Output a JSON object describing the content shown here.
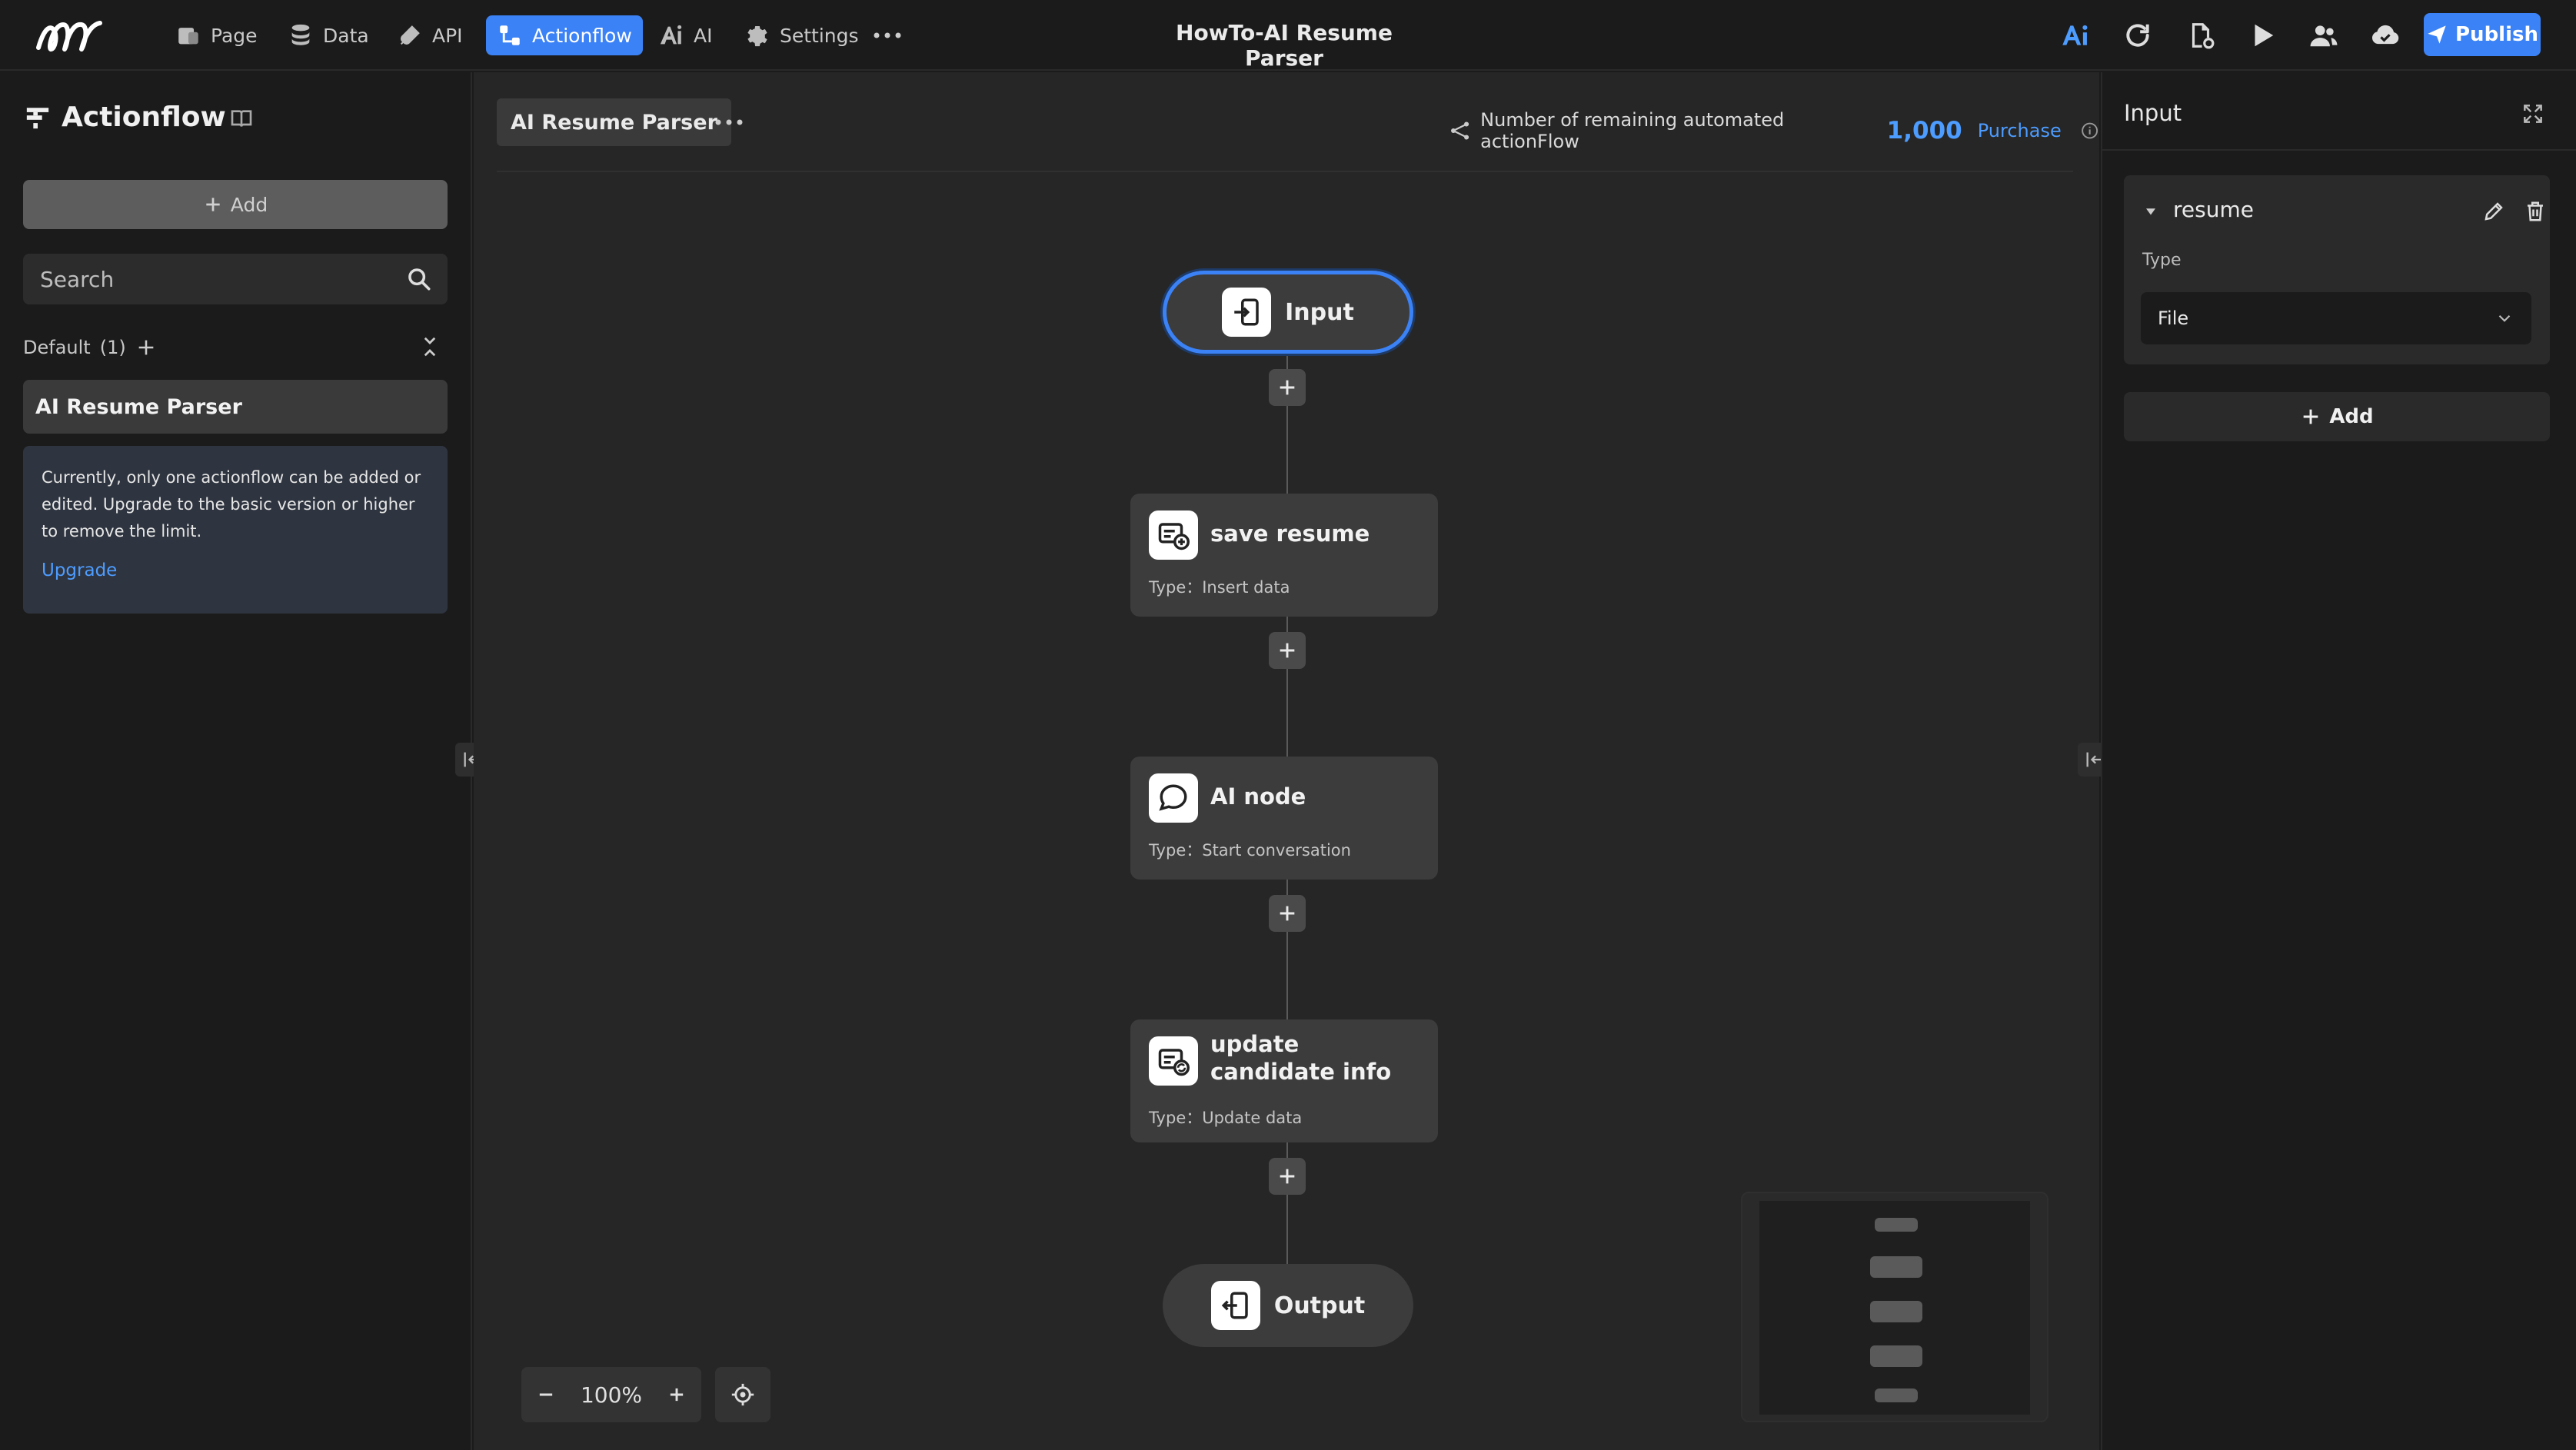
{
  "app": {
    "title": "HowTo-AI Resume Parser",
    "logo": "logo-mark",
    "accent_color": "#3b82f6",
    "nav": [
      {
        "label": "Page",
        "icon": "page-icon"
      },
      {
        "label": "Data",
        "icon": "database-icon"
      },
      {
        "label": "API",
        "icon": "plug-icon"
      },
      {
        "label": "Actionflow",
        "icon": "flow-icon",
        "active": true
      },
      {
        "label": "AI",
        "icon": "ai-icon"
      },
      {
        "label": "Settings",
        "icon": "gear-icon"
      }
    ],
    "more_icon": "more-icon",
    "toolbar_icons": [
      "ai-logo-icon",
      "refresh-icon",
      "file-settings-icon",
      "play-icon",
      "users-icon",
      "cloud-icon"
    ],
    "publish_label": "Publish"
  },
  "sidebar": {
    "title": "Actionflow",
    "add_label": "Add",
    "search_placeholder": "Search",
    "group_label": "Default",
    "group_count": "(1)",
    "items": [
      {
        "label": "AI Resume Parser"
      }
    ],
    "notice_text": "Currently, only one actionflow can be added or edited. Upgrade to the basic version or higher to remove the limit.",
    "upgrade_label": "Upgrade"
  },
  "canvas": {
    "tab_label": "AI Resume Parser",
    "quota_label": "Number of remaining automated actionFlow",
    "quota_value": "1,000",
    "purchase_label": "Purchase",
    "nodes": [
      {
        "name": "Input",
        "kind": "terminal",
        "selected": true
      },
      {
        "name": "save resume",
        "type": "Type：Insert data"
      },
      {
        "name": "AI node",
        "type": "Type：Start conversation"
      },
      {
        "name": "update candidate info",
        "type": "Type：Update data"
      },
      {
        "name": "Output",
        "kind": "terminal"
      }
    ],
    "zoom_level": "100%"
  },
  "right_panel": {
    "title": "Input",
    "param_name": "resume",
    "type_label": "Type",
    "type_value": "File",
    "add_label": "Add"
  }
}
